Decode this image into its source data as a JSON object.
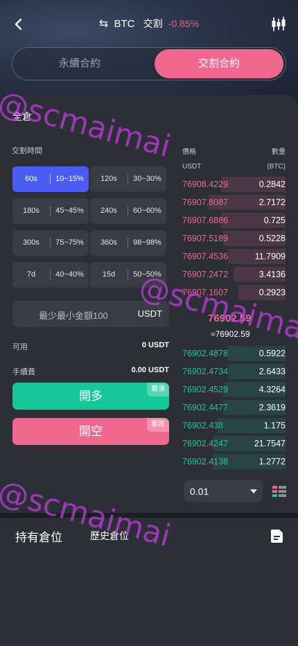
{
  "header": {
    "symbol": "BTC",
    "contract_type": "交割",
    "change": "-0.85%",
    "swap_glyph": "⇆"
  },
  "segments": {
    "perpetual": "永續合約",
    "delivery": "交割合約"
  },
  "trade": {
    "margin_mode": "全倉",
    "time_label": "交割時間",
    "time_options": [
      {
        "time": "60s",
        "rate": "10~15%"
      },
      {
        "time": "120s",
        "rate": "30~30%"
      },
      {
        "time": "180s",
        "rate": "45~45%"
      },
      {
        "time": "240s",
        "rate": "60~60%"
      },
      {
        "time": "300s",
        "rate": "75~75%"
      },
      {
        "time": "360s",
        "rate": "98~98%"
      },
      {
        "time": "7d",
        "rate": "40~40%"
      },
      {
        "time": "15d",
        "rate": "50~50%"
      }
    ],
    "amount_placeholder": "最少最小金額100",
    "amount_unit": "USDT",
    "available_label": "可用",
    "available_value": "0 USDT",
    "fee_label": "手續費",
    "fee_value": "0.00 USDT",
    "long_label": "開多",
    "long_tag": "看漲",
    "short_label": "開空",
    "short_tag": "看跌"
  },
  "orderbook": {
    "price_header": "價格",
    "price_unit": "USDT",
    "qty_header": "數量",
    "qty_unit": "(BTC)",
    "asks": [
      {
        "price": "76908.4229",
        "qty": "0.2842",
        "depth": 0.62
      },
      {
        "price": "76907.8087",
        "qty": "2.7172",
        "depth": 0.74
      },
      {
        "price": "76907.6886",
        "qty": "0.725",
        "depth": 0.62
      },
      {
        "price": "76907.5189",
        "qty": "0.5228",
        "depth": 0.6
      },
      {
        "price": "76907.4536",
        "qty": "11.7909",
        "depth": 0.55
      },
      {
        "price": "76907.2472",
        "qty": "3.4136",
        "depth": 0.5
      },
      {
        "price": "76907.1607",
        "qty": "0.2923",
        "depth": 0.45
      }
    ],
    "mid_price": "76902.59",
    "mid_sub": "≈76902.59",
    "bids": [
      {
        "price": "76902.4878",
        "qty": "0.5922",
        "depth": 0.55
      },
      {
        "price": "76902.4734",
        "qty": "2.6433",
        "depth": 0.55
      },
      {
        "price": "76902.4529",
        "qty": "4.3264",
        "depth": 0.6
      },
      {
        "price": "76902.4477",
        "qty": "2.3619",
        "depth": 0.6
      },
      {
        "price": "76902.438",
        "qty": "1.175",
        "depth": 0.65
      },
      {
        "price": "76902.4247",
        "qty": "21.7547",
        "depth": 0.7
      },
      {
        "price": "76902.4138",
        "qty": "1.2772",
        "depth": 0.7
      }
    ],
    "precision": "0.01"
  },
  "positions": {
    "holding_tab": "持有倉位",
    "history_tab": "歷史倉位"
  },
  "watermark": "@scmaimai",
  "colors": {
    "accent_pink": "#f0688f",
    "accent_green": "#17c79a",
    "selected_blue": "#4a5cf2",
    "panel": "#2d2f37"
  }
}
